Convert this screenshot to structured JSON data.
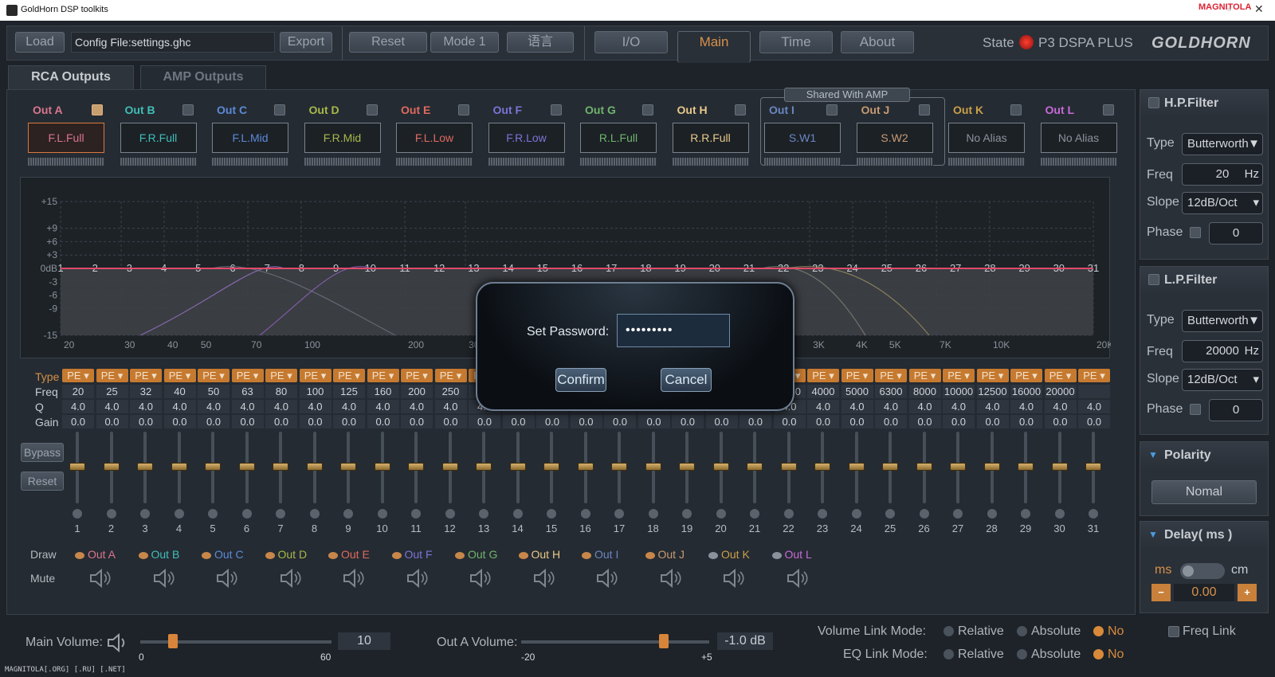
{
  "window": {
    "title": "GoldHorn DSP toolkits"
  },
  "toolbar": {
    "load": "Load",
    "config": "Config File:settings.ghc",
    "export": "Export",
    "reset": "Reset",
    "mode": "Mode 1",
    "lang": "语言",
    "io": "I/O",
    "main": "Main",
    "time": "Time",
    "about": "About",
    "state_label": "State",
    "device": "P3 DSPA PLUS",
    "brand": "GOLDHORN",
    "watermark": "MAGNITOLA"
  },
  "subtabs": {
    "rca": "RCA Outputs",
    "amp": "AMP Outputs"
  },
  "shared": "Shared With AMP",
  "channels": [
    {
      "name": "Out  A",
      "alias": "F.L.Full",
      "color": "#d9768e",
      "checked": true
    },
    {
      "name": "Out  B",
      "alias": "F.R.Full",
      "color": "#3fbfb8",
      "checked": false
    },
    {
      "name": "Out  C",
      "alias": "F.L.Mid",
      "color": "#5b8ad8",
      "checked": false
    },
    {
      "name": "Out  D",
      "alias": "F.R.Mid",
      "color": "#a7b84a",
      "checked": false
    },
    {
      "name": "Out  E",
      "alias": "F.L.Low",
      "color": "#e06a5e",
      "checked": false
    },
    {
      "name": "Out  F",
      "alias": "F.R.Low",
      "color": "#7b74d8",
      "checked": false
    },
    {
      "name": "Out  G",
      "alias": "R.L.Full",
      "color": "#6fb46c",
      "checked": false
    },
    {
      "name": "Out  H",
      "alias": "R.R.Full",
      "color": "#e8c98a",
      "checked": false
    },
    {
      "name": "Out  I",
      "alias": "S.W1",
      "color": "#6a86c2",
      "checked": false
    },
    {
      "name": "Out  J",
      "alias": "S.W2",
      "color": "#c79a72",
      "checked": false
    },
    {
      "name": "Out  K",
      "alias": "No Alias",
      "color": "#c9a04a",
      "checked": false
    },
    {
      "name": "Out  L",
      "alias": "No Alias",
      "color": "#c76ad8",
      "checked": false
    }
  ],
  "graph": {
    "ylabels": [
      "+15",
      "+9",
      "+6",
      "+3",
      "0dB",
      "-3",
      "-6",
      "-9",
      "-15"
    ],
    "xlabels": [
      "20",
      "30",
      "40",
      "50",
      "70",
      "100",
      "200",
      "300",
      "3K",
      "4K",
      "5K",
      "7K",
      "10K",
      "20K"
    ],
    "bandmarks": [
      "1",
      "2",
      "3",
      "4",
      "5",
      "6",
      "7",
      "8",
      "9",
      "10",
      "11",
      "12",
      "13",
      "14",
      "15",
      "16",
      "17",
      "18",
      "19",
      "20",
      "21",
      "22",
      "23",
      "24",
      "25",
      "26",
      "27",
      "28",
      "29",
      "30",
      "31"
    ]
  },
  "eq": {
    "labels": {
      "type": "Type",
      "freq": "Freq",
      "q": "Q",
      "gain": "Gain"
    },
    "type": "PE",
    "freqs": [
      "20",
      "25",
      "32",
      "40",
      "50",
      "63",
      "80",
      "100",
      "125",
      "160",
      "200",
      "250",
      "",
      "",
      "",
      "",
      "",
      "",
      "",
      "",
      "",
      "3150",
      "4000",
      "5000",
      "6300",
      "8000",
      "10000",
      "12500",
      "16000",
      "20000",
      ""
    ],
    "q": "4.0",
    "gain": "0.0",
    "bypass": "Bypass",
    "reset": "Reset"
  },
  "draw": {
    "label": "Draw",
    "mute": "Mute",
    "items": [
      "Out  A",
      "Out  B",
      "Out  C",
      "Out  D",
      "Out  E",
      "Out  F",
      "Out  G",
      "Out  H",
      "Out  I",
      "Out  J",
      "Out  K",
      "Out  L"
    ]
  },
  "modal": {
    "label": "Set Password:",
    "value": "•••••••••",
    "confirm": "Confirm",
    "cancel": "Cancel"
  },
  "hp": {
    "title": "H.P.Filter",
    "type_label": "Type",
    "type": "Butterworth",
    "freq_label": "Freq",
    "freq": "20",
    "unit": "Hz",
    "slope_label": "Slope",
    "slope": "12dB/Oct",
    "phase_label": "Phase",
    "phase": "0"
  },
  "lp": {
    "title": "L.P.Filter",
    "type_label": "Type",
    "type": "Butterworth",
    "freq_label": "Freq",
    "freq": "20000",
    "unit": "Hz",
    "slope_label": "Slope",
    "slope": "12dB/Oct",
    "phase_label": "Phase",
    "phase": "0"
  },
  "polarity": {
    "title": "Polarity",
    "value": "Nomal"
  },
  "delay": {
    "title": "Delay( ms )",
    "ms": "ms",
    "cm": "cm",
    "value": "0.00",
    "minus": "−",
    "plus": "+"
  },
  "bottom": {
    "main_vol": "Main Volume:",
    "main_min": "0",
    "main_max": "60",
    "main_val": "10",
    "main_level": 0.17,
    "outa_vol": "Out A Volume:",
    "outa_min": "-20",
    "outa_max": "+5",
    "outa_val": "-1.0",
    "outa_unit": "dB",
    "outa_level": 0.76,
    "vlm": "Volume Link Mode:",
    "eqlm": "EQ Link Mode:",
    "relative": "Relative",
    "absolute": "Absolute",
    "no": "No",
    "freqlink": "Freq Link"
  },
  "footer": "MAGNITOLA[.ORG] [.RU] [.NET]"
}
